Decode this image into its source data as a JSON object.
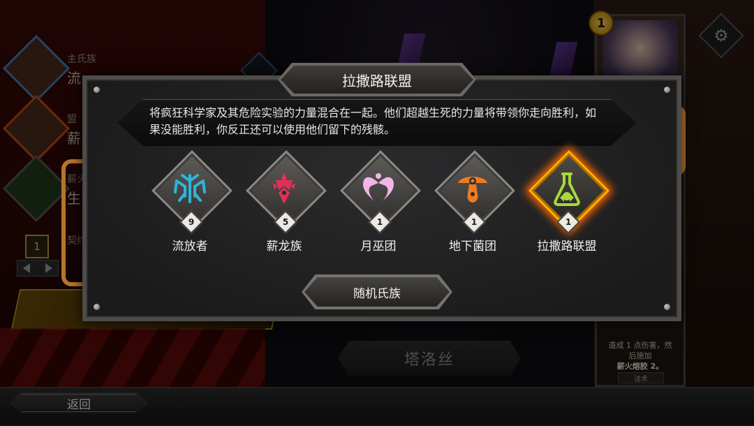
{
  "background": {
    "sidebar_rows": [
      {
        "label_small": "主氏族",
        "label_big": "流"
      },
      {
        "label_small": "盟",
        "label_big": "薪"
      },
      {
        "label_small": "薪火",
        "label_big": "生"
      },
      {
        "label_small": "契约",
        "label_big": ""
      }
    ],
    "book_level": "1",
    "champion_name": "塔洛丝",
    "card": {
      "cost": "1",
      "description_line1": "造成 1 点伤害，然",
      "description_line2": "后施加",
      "description_line3": "薪火熔胶 2。",
      "type": "法术"
    }
  },
  "dialog": {
    "title": "拉撒路联盟",
    "description": "将疯狂科学家及其危险实验的力量混合在一起。他们超越生死的力量将带领你走向胜利，如果没能胜利，你反正还可以使用他们留下的残骸。",
    "clans": [
      {
        "name": "流放者",
        "count": "9",
        "icon": "hellhorned-icon",
        "color": "#2fb5d8"
      },
      {
        "name": "薪龙族",
        "count": "5",
        "icon": "awoken-icon",
        "color": "#e0305a"
      },
      {
        "name": "月巫团",
        "count": "1",
        "icon": "lunar-coven-icon",
        "color": "#f0b6ea"
      },
      {
        "name": "地下菌团",
        "count": "1",
        "icon": "underlegion-icon",
        "color": "#f07a22"
      },
      {
        "name": "拉撒路联盟",
        "count": "1",
        "icon": "flask-icon",
        "color": "#a8d83a"
      }
    ],
    "selected_clan": "拉撒路联盟",
    "random_button": "随机氏族"
  },
  "bottom": {
    "back_button": "返回"
  },
  "colors": {
    "accent_glow": "#ff6a00",
    "pipe": "#b8742e"
  }
}
